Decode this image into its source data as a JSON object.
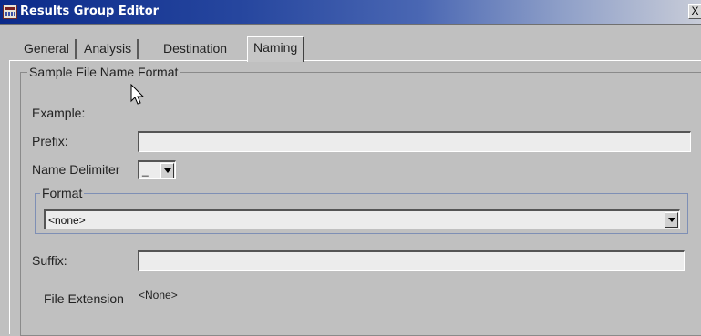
{
  "window": {
    "title": "Results Group Editor",
    "close_glyph": "X",
    "app_icon": "results-group-icon"
  },
  "tabs": [
    {
      "label": "General",
      "selected": false
    },
    {
      "label": "Analysis",
      "selected": false
    },
    {
      "label": "Destination",
      "selected": false
    },
    {
      "label": "Naming",
      "selected": true
    }
  ],
  "sample_format": {
    "legend": "Sample File Name Format",
    "example_label": "Example:",
    "prefix_label": "Prefix:",
    "prefix_value": "",
    "delimiter_label": "Name Delimiter",
    "delimiter_value": "_",
    "format_legend": "Format",
    "format_value": "<none>",
    "suffix_label": "Suffix:",
    "suffix_value": "",
    "extension_label": "File Extension",
    "extension_value": "<None>"
  },
  "colors": {
    "window_bg": "#c0c0c0",
    "title_start": "#0b2a8a",
    "title_end": "#c8ccd8",
    "field_bg": "#ececec"
  }
}
